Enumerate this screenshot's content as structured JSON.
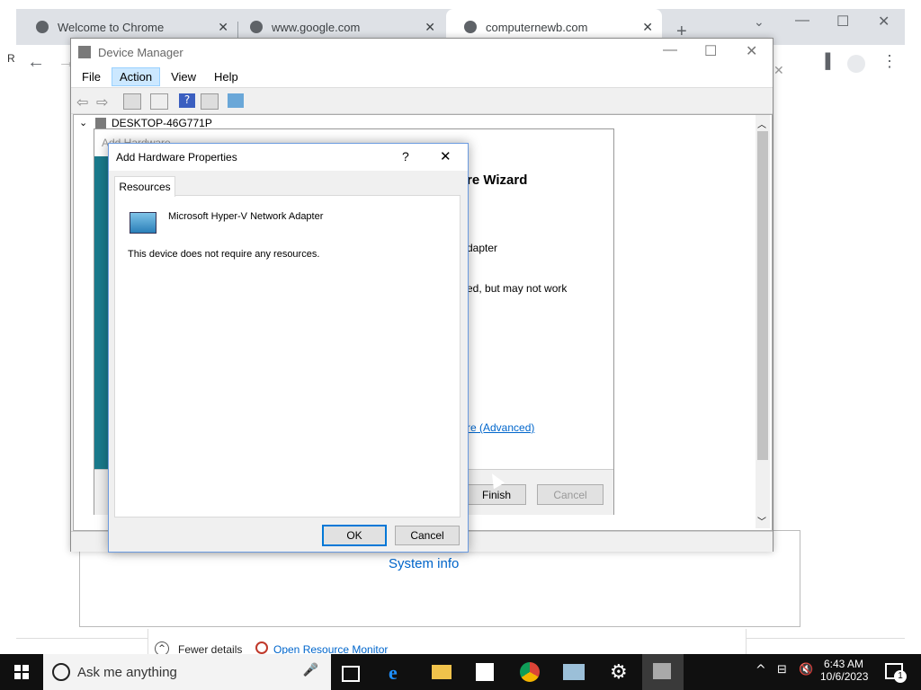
{
  "chrome": {
    "tabs": [
      {
        "label": "Welcome to Chrome"
      },
      {
        "label": "www.google.com"
      },
      {
        "label": "computernewb.com"
      }
    ],
    "new_tab_glyph": "+",
    "truncated_left_char": "R"
  },
  "device_manager": {
    "title": "Device Manager",
    "menu": [
      "File",
      "Action",
      "View",
      "Help"
    ],
    "active_menu": "Action",
    "tree_root": "DESKTOP-46G771P"
  },
  "wizard": {
    "title_partial": "Add Hardware",
    "heading_partial": "re Wizard",
    "line1_partial": "dapter",
    "line2_partial": "ed, but may not work",
    "link_partial": "re (Advanced)",
    "finish_label": "Finish",
    "cancel_label": "Cancel"
  },
  "dialog": {
    "title": "Add Hardware Properties",
    "help_glyph": "?",
    "tab_label": "Resources",
    "device_name": "Microsoft Hyper-V Network Adapter",
    "message": "This device does not require any resources.",
    "ok_label": "OK",
    "cancel_label": "Cancel"
  },
  "background": {
    "system_info_link": "System info",
    "fewer_details": "Fewer details",
    "open_resource_monitor": "Open Resource Monitor"
  },
  "taskbar": {
    "search_placeholder": "Ask me anything",
    "time": "6:43 AM",
    "date": "10/6/2023",
    "notification_count": "1"
  },
  "colors": {
    "accent": "#0078d7",
    "link": "#0066cc",
    "taskbar": "#101010",
    "wizard_side": "#1a7a8c"
  }
}
